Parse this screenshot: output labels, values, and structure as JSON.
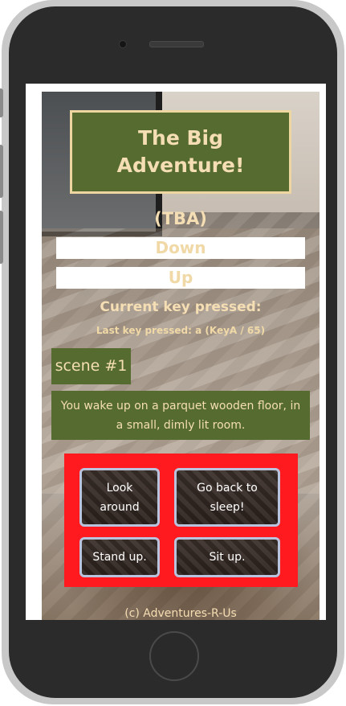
{
  "game": {
    "title": "The Big Adventure!",
    "status": "(TBA)",
    "direction_down": "Down",
    "direction_up": "Up",
    "current_key_label": "Current key pressed:",
    "last_key_label": "Last key pressed: a (KeyA / 65)",
    "scene_label": "scene #1",
    "narrative": "You wake up on a parquet wooden floor, in a small, dimly lit room.",
    "choices": [
      {
        "label": "Look around"
      },
      {
        "label": "Go back to sleep!"
      },
      {
        "label": "Stand up."
      },
      {
        "label": "Sit up."
      }
    ],
    "footer": "(c) Adventures-R-Us"
  },
  "colors": {
    "panel_green": "#556b2f",
    "text_wheat": "#f5deb3",
    "choices_red": "#ff1a1f",
    "button_border": "#b9c3dd"
  }
}
